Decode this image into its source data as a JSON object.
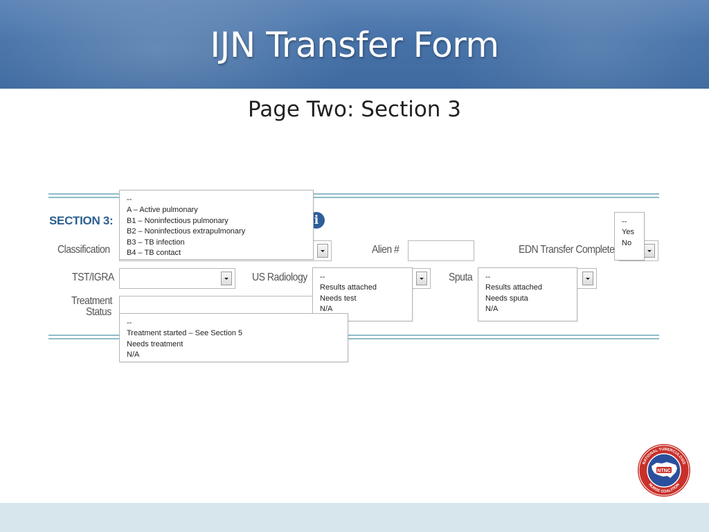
{
  "header": {
    "title": "IJN Transfer Form"
  },
  "slide": {
    "subtitle": "Page Two: Section 3"
  },
  "form": {
    "section_label": "SECTION 3:",
    "labels": {
      "classification": "Classification",
      "alien": "Alien #",
      "edn_transfer": "EDN Transfer Complete",
      "tst_igra": "TST/IGRA",
      "us_radiology": "US Radiology",
      "sputa": "Sputa",
      "treatment_line1": "Treatment",
      "treatment_line2": "Status"
    },
    "dropdowns": {
      "classification": [
        "--",
        "A – Active pulmonary",
        "B1 – Noninfectious pulmonary",
        "B2 – Noninfectious extrapulmonary",
        "B3 – TB infection",
        "B4 – TB contact"
      ],
      "edn_transfer": [
        "--",
        "Yes",
        "No"
      ],
      "us_radiology": [
        "--",
        "Results attached",
        "Needs test",
        "N/A"
      ],
      "sputa": [
        "--",
        "Results attached",
        "Needs sputa",
        "N/A"
      ],
      "treatment_status": [
        "--",
        "Treatment started – See Section 5",
        "Needs treatment",
        "N/A"
      ]
    }
  },
  "logo": {
    "ring_text_top": "NATIONAL TUBERCULOSIS",
    "ring_text_bottom": "NURSE COALITION",
    "center": "NTNC",
    "colors": {
      "ring": "#c8302a",
      "inner": "#2a4f9c",
      "map": "#ffffff"
    }
  }
}
